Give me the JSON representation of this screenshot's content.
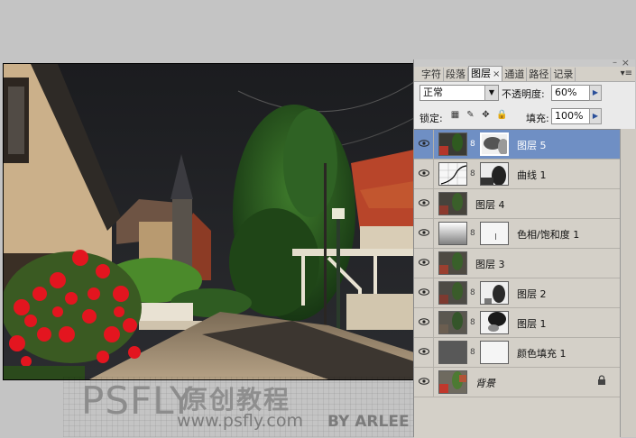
{
  "panel": {
    "tabs": [
      "字符",
      "段落",
      "图层",
      "通道",
      "路径",
      "记录"
    ],
    "active_tab": "图层",
    "tab_close_glyph": "×",
    "menu_glyph": "▾≡",
    "window_minimize": "–",
    "window_close": "×"
  },
  "controls": {
    "blend_mode": "正常",
    "opacity_label": "不透明度:",
    "opacity_value": "60%",
    "lock_label": "锁定:",
    "fill_label": "填充:",
    "fill_value": "100%"
  },
  "layers": [
    {
      "name": "图层 5",
      "thumb": "photo",
      "mask": "clouds",
      "selected": true
    },
    {
      "name": "曲线 1",
      "thumb": "curves",
      "mask": "tree-mask",
      "selected": false
    },
    {
      "name": "图层 4",
      "thumb": "photo",
      "mask": "",
      "selected": false
    },
    {
      "name": "色相/饱和度 1",
      "thumb": "hue-sat",
      "mask": "white-line",
      "selected": false
    },
    {
      "name": "图层 3",
      "thumb": "photo",
      "mask": "",
      "selected": false
    },
    {
      "name": "图层 2",
      "thumb": "photo",
      "mask": "tree-mask",
      "selected": false
    },
    {
      "name": "图层 1",
      "thumb": "photo",
      "mask": "dark-tree",
      "selected": false
    },
    {
      "name": "颜色填充 1",
      "thumb": "gray-fill",
      "mask": "white",
      "selected": false
    },
    {
      "name": "背景",
      "thumb": "photo",
      "mask": "",
      "selected": false,
      "locked": true
    }
  ],
  "watermark": {
    "brand": "PSFLY",
    "cn": "原创教程",
    "url": "www.psfly.com",
    "by": "BY ARLEE"
  },
  "colors": {
    "selected_layer": "#6f8fc4",
    "panel_bg": "#d4d0c8",
    "flowers": "#e3151f"
  }
}
